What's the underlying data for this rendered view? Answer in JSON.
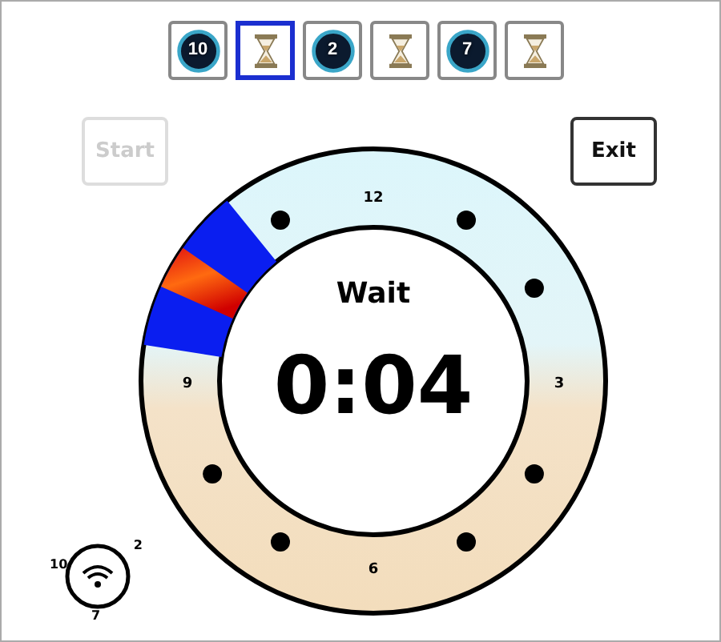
{
  "toolbar": [
    {
      "kind": "countdown",
      "label": "10",
      "selected": false
    },
    {
      "kind": "hourglass",
      "selected": true
    },
    {
      "kind": "countdown",
      "label": "2",
      "selected": false
    },
    {
      "kind": "hourglass",
      "selected": false
    },
    {
      "kind": "countdown",
      "label": "7",
      "selected": false
    },
    {
      "kind": "hourglass",
      "selected": false
    }
  ],
  "start_button": {
    "label": "Start",
    "disabled": true
  },
  "exit_button": {
    "label": "Exit",
    "disabled": false
  },
  "dial": {
    "hour_labels": [
      "12",
      "3",
      "6",
      "9"
    ],
    "status": "Wait",
    "time": "0:04"
  },
  "wifi_indicator": {
    "labels": [
      "10",
      "2",
      "7"
    ]
  }
}
